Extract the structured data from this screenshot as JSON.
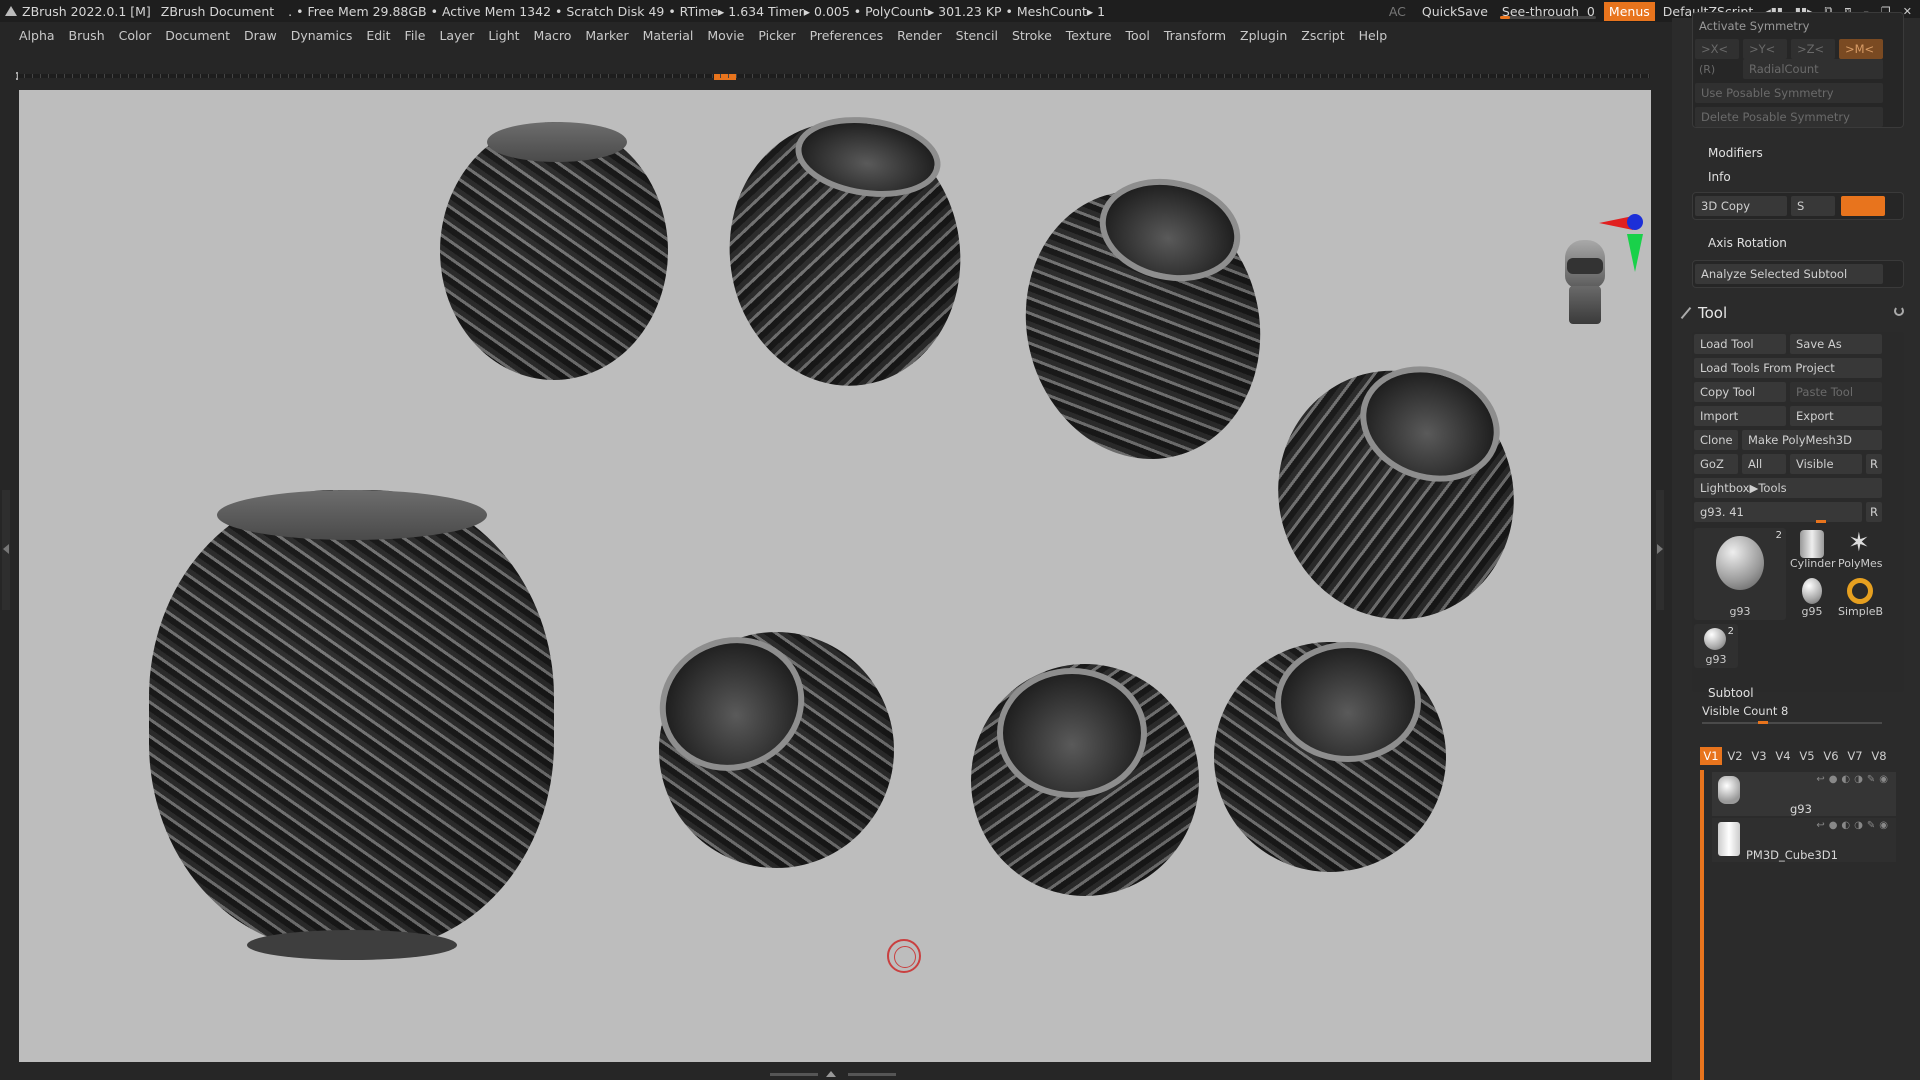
{
  "titlebar": {
    "app": "ZBrush 2022.0.1 [M]",
    "document": "ZBrush Document",
    "stats": ". • Free Mem 29.88GB • Active Mem 1342 • Scratch Disk 49 •  RTime▸ 1.634 Timer▸ 0.005 • PolyCount▸ 301.23 KP  • MeshCount▸ 1",
    "ac": "AC",
    "quicksave": "QuickSave",
    "seethrough_label": "See-through",
    "seethrough_value": "0",
    "menus": "Menus",
    "script": "DefaultZScript"
  },
  "menubar": [
    "Alpha",
    "Brush",
    "Color",
    "Document",
    "Draw",
    "Dynamics",
    "Edit",
    "File",
    "Layer",
    "Light",
    "Macro",
    "Marker",
    "Material",
    "Movie",
    "Picker",
    "Preferences",
    "Render",
    "Stencil",
    "Stroke",
    "Texture",
    "Tool",
    "Transform",
    "Zplugin",
    "Zscript",
    "Help"
  ],
  "panel": {
    "symmetry": {
      "title": "Activate Symmetry",
      "x": ">X<",
      "y": ">Y<",
      "z": ">Z<",
      "m": ">M<",
      "r": "(R)",
      "radial": "RadialCount",
      "posable": "Use Posable Symmetry",
      "delete_posable": "Delete Posable Symmetry"
    },
    "modifiers": "Modifiers",
    "info": "Info",
    "copy3d": "3D Copy",
    "copy3d_s": "S",
    "axis_rotation": "Axis Rotation",
    "analyze": "Analyze Selected Subtool",
    "tool_title": "Tool",
    "load_tool": "Load Tool",
    "save_as": "Save As",
    "load_from_project": "Load Tools From Project",
    "copy_tool": "Copy Tool",
    "paste_tool": "Paste Tool",
    "import": "Import",
    "export": "Export",
    "clone": "Clone",
    "make_polymesh": "Make PolyMesh3D",
    "goz": "GoZ",
    "all": "All",
    "visible": "Visible",
    "r": "R",
    "lightbox_tools": "Lightbox▶Tools",
    "current_tool": "g93. 41",
    "current_tool_r": "R",
    "thumbs": {
      "main": {
        "name": "g93",
        "count": "2"
      },
      "cylinder": "Cylinder",
      "polymesh": "PolyMes",
      "g95": "g95",
      "simpleb": "SimpleB",
      "small": {
        "name": "g93",
        "count": "2"
      }
    },
    "subtool": {
      "title": "Subtool",
      "visible_count": "Visible Count 8",
      "tabs": [
        "V1",
        "V2",
        "V3",
        "V4",
        "V5",
        "V6",
        "V7",
        "V8"
      ],
      "active_tab": 0,
      "items": [
        {
          "name": "g93"
        },
        {
          "name": "PM3D_Cube3D1"
        }
      ]
    }
  },
  "colors": {
    "accent": "#e8741d",
    "canvas_bg": "#bdbdbd",
    "cursor": "#c94040"
  }
}
